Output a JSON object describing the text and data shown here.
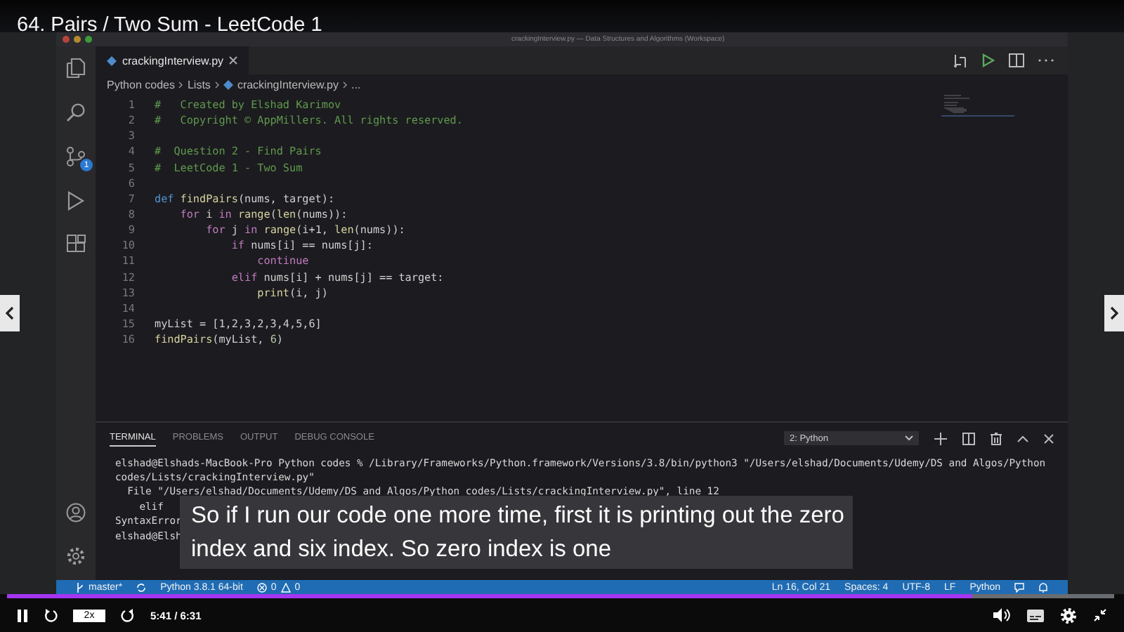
{
  "lecture_title": "64. Pairs / Two Sum - LeetCode 1",
  "editor": {
    "window_title": "crackingInterview.py — Data Structures and Algorithms (Workspace)",
    "source_control_badge": "1",
    "tabs": [
      {
        "label": "crackingInterview.py",
        "selected": true
      }
    ],
    "breadcrumb": [
      {
        "label": "Python codes",
        "kind": "folder"
      },
      {
        "label": "Lists",
        "kind": "folder"
      },
      {
        "label": "crackingInterview.py",
        "kind": "file"
      },
      {
        "label": "...",
        "kind": "more"
      }
    ],
    "code_lines": [
      {
        "number": "1",
        "tokens": [
          {
            "kind": "comment",
            "text": "#   Created by Elshad Karimov"
          }
        ]
      },
      {
        "number": "2",
        "tokens": [
          {
            "kind": "comment",
            "text": "#   Copyright © AppMillers. All rights reserved."
          }
        ]
      },
      {
        "number": "3"
      },
      {
        "number": "4",
        "tokens": [
          {
            "kind": "comment",
            "text": "#  Question 2 - Find Pairs"
          }
        ]
      },
      {
        "number": "5",
        "tokens": [
          {
            "kind": "comment",
            "text": "#  LeetCode 1 - Two Sum"
          }
        ]
      },
      {
        "number": "6"
      },
      {
        "number": "7",
        "tokens": [
          {
            "kind": "keyword",
            "text": "def"
          },
          {
            "kind": "function",
            "text": " findPairs"
          },
          {
            "kind": "plain",
            "text": "(nums, target):"
          }
        ]
      },
      {
        "number": "8",
        "tokens": [
          {
            "kind": "control",
            "text": "    for"
          },
          {
            "kind": "plain",
            "text": " i "
          },
          {
            "kind": "control",
            "text": "in"
          },
          {
            "kind": "function",
            "text": " range"
          },
          {
            "kind": "plain",
            "text": "("
          },
          {
            "kind": "function",
            "text": "len"
          },
          {
            "kind": "plain",
            "text": "(nums)):"
          }
        ]
      },
      {
        "number": "9",
        "tokens": [
          {
            "kind": "control",
            "text": "        for"
          },
          {
            "kind": "plain",
            "text": " j "
          },
          {
            "kind": "control",
            "text": "in"
          },
          {
            "kind": "function",
            "text": " range"
          },
          {
            "kind": "plain",
            "text": "(i+1, "
          },
          {
            "kind": "function",
            "text": "len"
          },
          {
            "kind": "plain",
            "text": "(nums)):"
          }
        ]
      },
      {
        "number": "10",
        "tokens": [
          {
            "kind": "control",
            "text": "            if"
          },
          {
            "kind": "plain",
            "text": " nums[i] == nums[j]:"
          }
        ]
      },
      {
        "number": "11",
        "tokens": [
          {
            "kind": "control",
            "text": "                continue"
          }
        ]
      },
      {
        "number": "12",
        "tokens": [
          {
            "kind": "control",
            "text": "            elif"
          },
          {
            "kind": "plain",
            "text": " nums[i] + nums[j] == target:"
          }
        ]
      },
      {
        "number": "13",
        "tokens": [
          {
            "kind": "function",
            "text": "                print"
          },
          {
            "kind": "plain",
            "text": "(i, j)"
          }
        ]
      },
      {
        "number": "14"
      },
      {
        "number": "15",
        "tokens": [
          {
            "kind": "plain",
            "text": "myList = [1,2,3,2,3,4,5,6]"
          }
        ]
      },
      {
        "number": "16",
        "tokens": [
          {
            "kind": "function",
            "text": "findPairs"
          },
          {
            "kind": "plain",
            "text": "(myList, "
          },
          {
            "kind": "number",
            "text": "6"
          },
          {
            "kind": "plain",
            "text": ")"
          }
        ]
      }
    ],
    "panel": {
      "tabs": [
        {
          "label": "TERMINAL",
          "selected": true
        },
        {
          "label": "PROBLEMS",
          "selected": false
        },
        {
          "label": "OUTPUT",
          "selected": false
        },
        {
          "label": "DEBUG CONSOLE",
          "selected": false
        }
      ],
      "terminal_select": "2: Python",
      "terminal_lines": [
        "elshad@Elshads-MacBook-Pro Python codes % /Library/Frameworks/Python.framework/Versions/3.8/bin/python3 \"/Users/elshad/Documents/Udemy/DS and Algos/Python",
        "codes/Lists/crackingInterview.py\"",
        "  File \"/Users/elshad/Documents/Udemy/DS and Algos/Python codes/Lists/crackingInterview.py\", line 12",
        "    elif",
        "SyntaxError",
        "elshad@Elsh"
      ]
    },
    "status_bar": {
      "branch": "master*",
      "interpreter": "Python 3.8.1 64-bit",
      "errors": "0",
      "warnings": "0",
      "right_items": [
        "Ln 16, Col 21",
        "Spaces: 4",
        "UTF-8",
        "LF",
        "Python"
      ]
    }
  },
  "subtitle": [
    "So if I run our code one more time, first it is printing out the zero",
    "index and six index. So zero index is one"
  ],
  "player": {
    "progress": {
      "level": 0.872
    },
    "speed": "2x",
    "time": "5:41 / 6:31"
  }
}
